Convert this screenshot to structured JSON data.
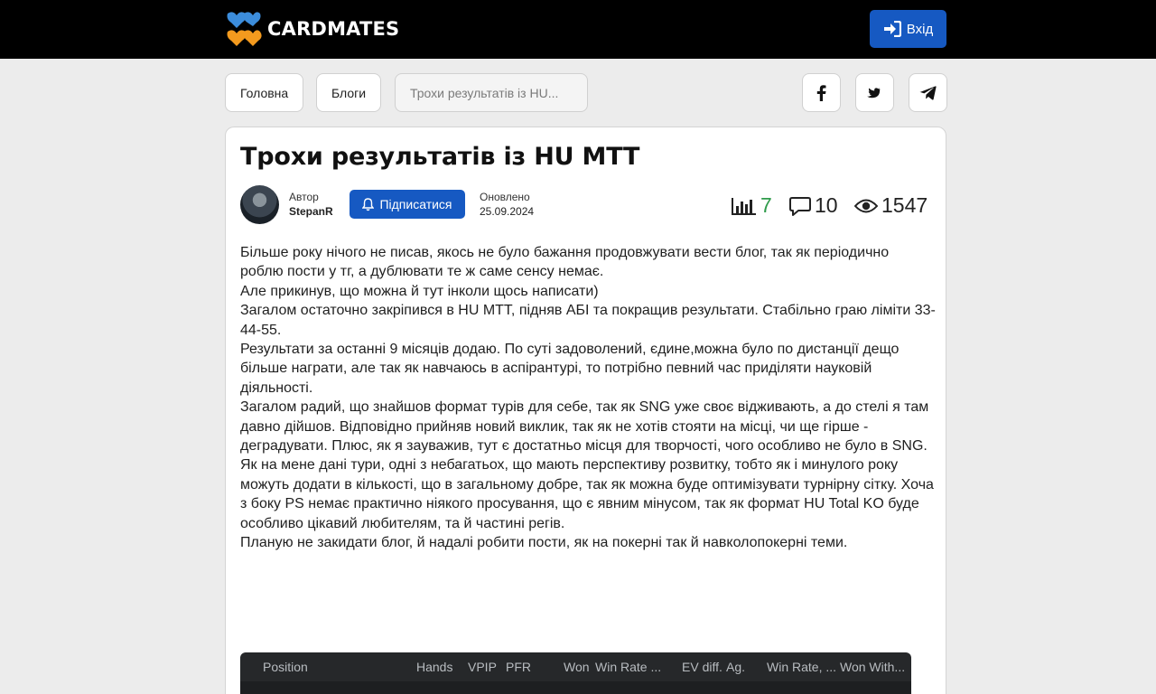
{
  "header": {
    "brand": "CARDMATES",
    "login_label": "Вхід",
    "colors": {
      "bar": "#000000",
      "accent": "#1659c2",
      "logo_orange": "#f39a1e",
      "logo_blue": "#3c8ddc"
    }
  },
  "breadcrumbs": [
    {
      "label": "Головна"
    },
    {
      "label": "Блоги"
    },
    {
      "label": "Трохи результатів із HU..."
    }
  ],
  "share": [
    {
      "icon": "facebook-icon"
    },
    {
      "icon": "twitter-icon"
    },
    {
      "icon": "telegram-icon"
    }
  ],
  "post": {
    "title": "Трохи результатів із HU MTT",
    "author_label": "Автор",
    "author": "StepanR",
    "subscribe_label": "Підписатися",
    "updated_label": "Оновлено",
    "updated_date": "25.09.2024",
    "stats": {
      "rating": "7",
      "comments": "10",
      "views": "1547"
    },
    "paragraphs": [
      "Більше року нічого не писав, якось не було бажання продовжувати вести блог, так як періодично роблю пости у тг, а дублювати те ж саме сенсу немає.",
      "Але прикинув, що можна й тут інколи щось написати)",
      "Загалом остаточно закріпився в HU MTT, підняв АБІ та покращив результати. Стабільно граю ліміти 33-44-55.",
      "Результати за останні 9 місяців додаю. По суті задоволений, єдине,можна було по дистанції дещо більше награти, але так як навчаюсь в аспірантурі, то потрібно певний час приділяти науковій діяльності.",
      "Загалом радий, що знайшов формат турів для себе, так як SNG уже своє відживають, а до стелі я там давно дійшов. Відповідно прийняв новий виклик, так як не хотів стояти на місці, чи ще гірше - деградувати. Плюс, як я зауважив, тут є достатньо місця для творчості, чого особливо не було в SNG.",
      "Як на мене дані тури, одні з небагатьох, що мають перспективу розвитку, тобто як і минулого року можуть додати в кількості, що в загальному добре, так як можна буде оптимізувати турнірну сітку. Хоча з боку PS немає практично ніякого просування, що є явним мінусом, так як формат HU Total KO буде особливо цікавий любителям, та й частині регів.",
      "Планую не закидати блог, й надалі робити пости, як на покерні так й навколопокерні теми."
    ]
  },
  "results_table": {
    "columns": [
      "Position",
      "Hands",
      "VPIP",
      "PFR",
      "Won",
      "Win Rate ...",
      "EV diff.",
      "Ag.",
      "Win Rate, ...",
      "Won With..."
    ]
  }
}
